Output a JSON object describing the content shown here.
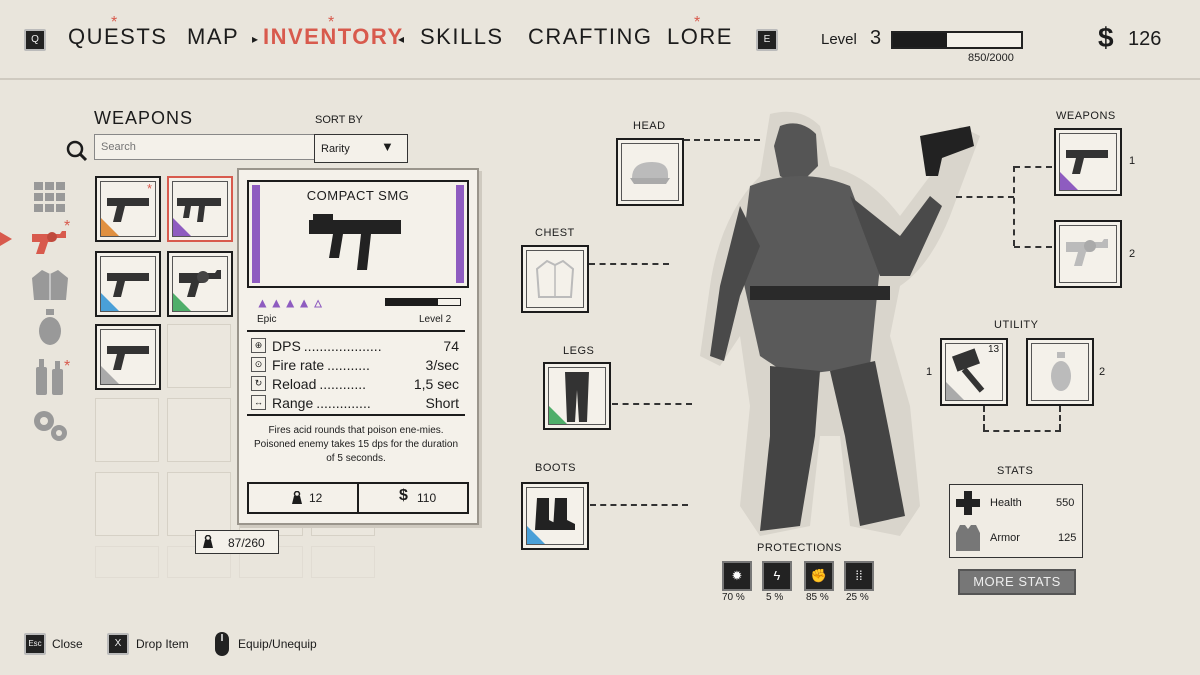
{
  "nav": {
    "left_key": "Q",
    "right_key": "E",
    "items": [
      {
        "label": "QUESTS",
        "starred": true
      },
      {
        "label": "MAP",
        "starred": false
      },
      {
        "label": "INVENTORY",
        "starred": true,
        "active": true
      },
      {
        "label": "SKILLS",
        "starred": false
      },
      {
        "label": "CRAFTING",
        "starred": false
      },
      {
        "label": "LORE",
        "starred": true
      }
    ],
    "level_label": "Level",
    "level_value": "3",
    "xp_text": "850/2000",
    "xp_fraction": 0.425,
    "money_symbol": "$",
    "money": "126"
  },
  "weapons_panel": {
    "title": "WEAPONS",
    "search_placeholder": "Search",
    "sort_label": "SORT BY",
    "sort_value": "Rarity",
    "capacity": "87/260"
  },
  "card": {
    "title": "COMPACT SMG",
    "rarity": "Epic",
    "level": "Level 2",
    "stars": 4,
    "stars_total": 5,
    "stats": [
      {
        "icon": "target-icon",
        "name": "DPS",
        "dots": "....................",
        "value": "74"
      },
      {
        "icon": "crosshair-icon",
        "name": "Fire rate",
        "dots": "...........",
        "value": "3/sec"
      },
      {
        "icon": "reload-icon",
        "name": "Reload",
        "dots": "............",
        "value": "1,5 sec"
      },
      {
        "icon": "range-icon",
        "name": "Range",
        "dots": "..............",
        "value": "Short"
      }
    ],
    "description": "Fires acid rounds that poison ene-mies. Poisoned enemy takes 15 dps for the duration of 5 seconds.",
    "weight": "12",
    "price": "110"
  },
  "equipment": {
    "head": "HEAD",
    "chest": "CHEST",
    "legs": "LEGS",
    "boots": "BOOTS",
    "weapons": "WEAPONS",
    "weapon_slot_1": "1",
    "weapon_slot_2": "2",
    "utility": "UTILITY",
    "utility_slot_1": "1",
    "utility_slot_2": "2",
    "utility_count": "13"
  },
  "stats": {
    "title": "STATS",
    "health_label": "Health",
    "health_value": "550",
    "armor_label": "Armor",
    "armor_value": "125",
    "more_button": "MORE STATS"
  },
  "protections": {
    "title": "PROTECTIONS",
    "items": [
      {
        "icon": "explosion-icon",
        "value": "70 %"
      },
      {
        "icon": "lightning-icon",
        "value": "5 %"
      },
      {
        "icon": "fist-icon",
        "value": "85 %"
      },
      {
        "icon": "bullets-icon",
        "value": "25 %"
      }
    ]
  },
  "hints": [
    {
      "key": "Esc",
      "label": "Close"
    },
    {
      "key": "X",
      "label": "Drop Item"
    },
    {
      "key": "mouse",
      "label": "Equip/Unequip"
    }
  ],
  "colors": {
    "accent": "#d85a4d",
    "epic": "#8e5cc0",
    "orange": "#e09040",
    "blue": "#4aa0d8",
    "green": "#4fae6a",
    "gray": "#aaaaaa"
  }
}
